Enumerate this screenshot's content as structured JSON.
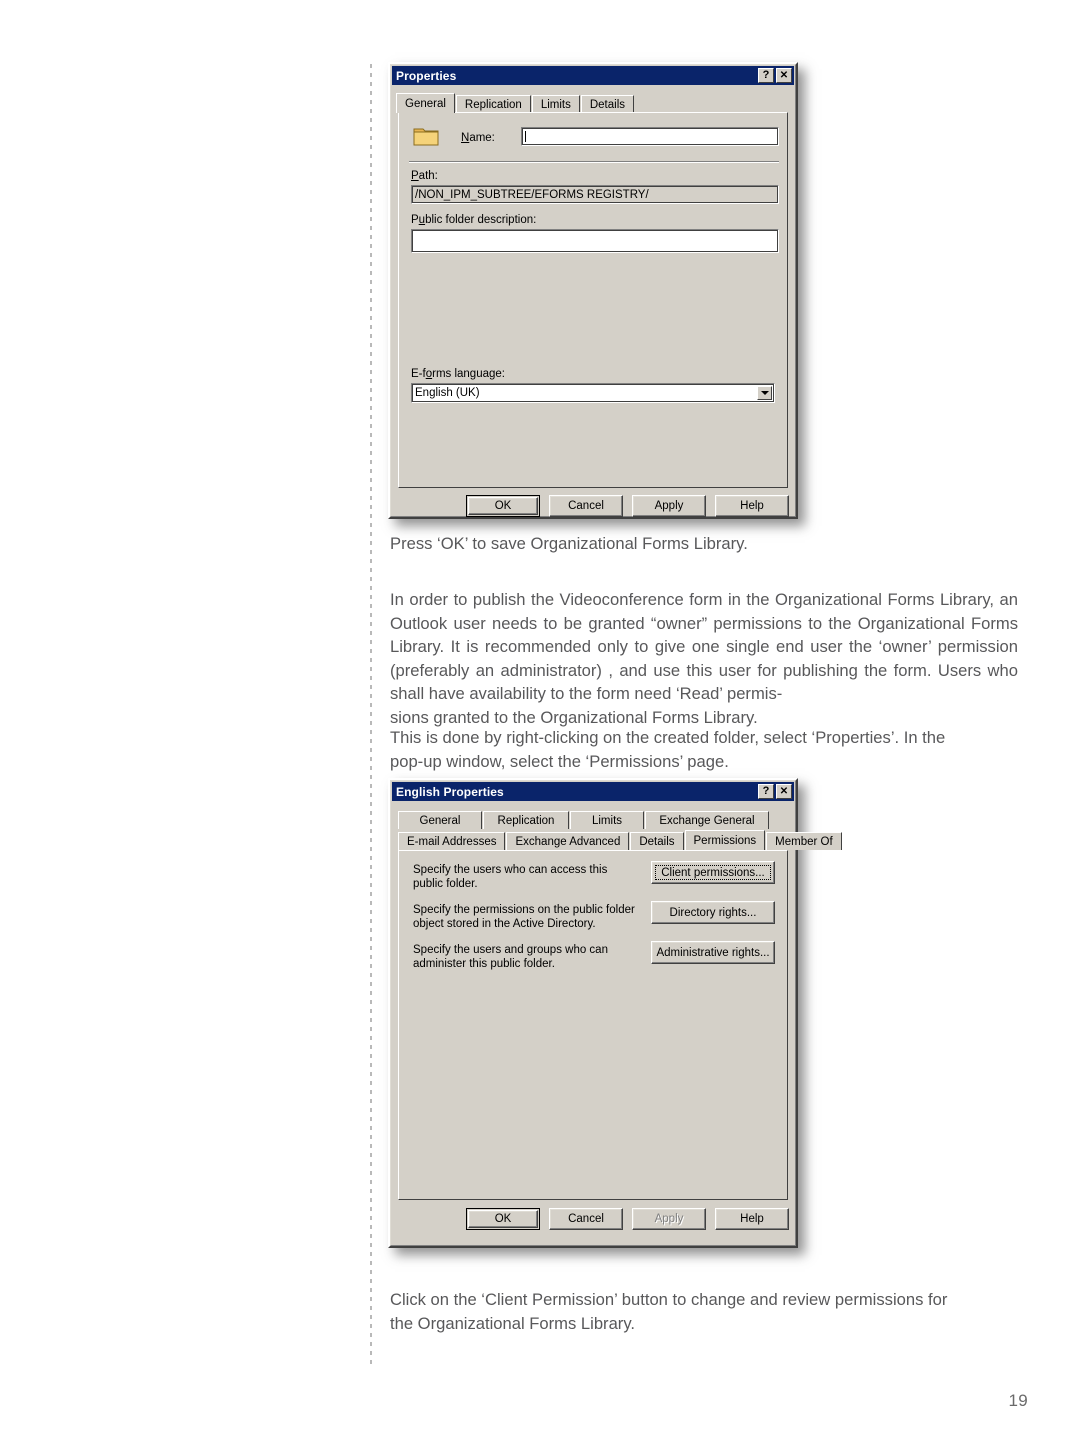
{
  "page": {
    "number": "19"
  },
  "dialog1": {
    "title": "Properties",
    "help_btn": "?",
    "close_btn": "✕",
    "tabs": [
      {
        "label": "General",
        "active": true
      },
      {
        "label": "Replication",
        "active": false
      },
      {
        "label": "Limits",
        "active": false
      },
      {
        "label": "Details",
        "active": false
      }
    ],
    "name_label": "Name:",
    "name_value": "",
    "path_label": "Path:",
    "path_value": "/NON_IPM_SUBTREE/EFORMS REGISTRY/",
    "description_label": "Public folder description:",
    "description_value": "",
    "language_label": "E-forms language:",
    "language_value": "English (UK)",
    "buttons": {
      "ok": "OK",
      "cancel": "Cancel",
      "apply": "Apply",
      "help": "Help"
    }
  },
  "caption1": "Press ‘OK’ to save Organizational Forms Library.",
  "paragraph1": "In order to publish the Videoconference form in the Organizational Forms Library, an Outlook user needs to be granted “owner” permissions to the Organizational Forms Library. It is recommended only to give one single end user the ‘owner’ permission (preferably an administrator) , and use this user for publishing the form. Users who shall have availability to the form need ‘Read’ permis-",
  "paragraph1_last": "sions granted to the Organizational Forms Library.",
  "paragraph2": "This is done by right-clicking on the created folder, select ‘Properties’. In the",
  "paragraph2_last": "pop-up window, select the ‘Permissions’ page.",
  "dialog2": {
    "title": "English Properties",
    "help_btn": "?",
    "close_btn": "✕",
    "tabs_row1": [
      {
        "label": "General",
        "active": false
      },
      {
        "label": "Replication",
        "active": false
      },
      {
        "label": "Limits",
        "active": false
      },
      {
        "label": "Exchange General",
        "active": false
      }
    ],
    "tabs_row2": [
      {
        "label": "E-mail Addresses",
        "active": false
      },
      {
        "label": "Exchange Advanced",
        "active": false
      },
      {
        "label": "Details",
        "active": false
      },
      {
        "label": "Permissions",
        "active": true
      },
      {
        "label": "Member Of",
        "active": false
      }
    ],
    "rows": [
      {
        "description": "Specify the users who can access this public folder.",
        "button": "Client permissions...",
        "focused": true
      },
      {
        "description": "Specify the permissions on the public folder object stored in the Active Directory.",
        "button": "Directory rights...",
        "focused": false
      },
      {
        "description": "Specify the users and groups who can administer this public folder.",
        "button": "Administrative rights...",
        "focused": false
      }
    ],
    "buttons": {
      "ok": "OK",
      "cancel": "Cancel",
      "apply": "Apply",
      "help": "Help"
    }
  },
  "paragraph3": "Click on the ‘Client Permission’ button to change and review permissions for",
  "paragraph3_last": "the Organizational Forms Library.",
  "colors": {
    "titlebar": "#0a246a",
    "dialog_face": "#d4d0c8",
    "body_text": "#58585a"
  }
}
